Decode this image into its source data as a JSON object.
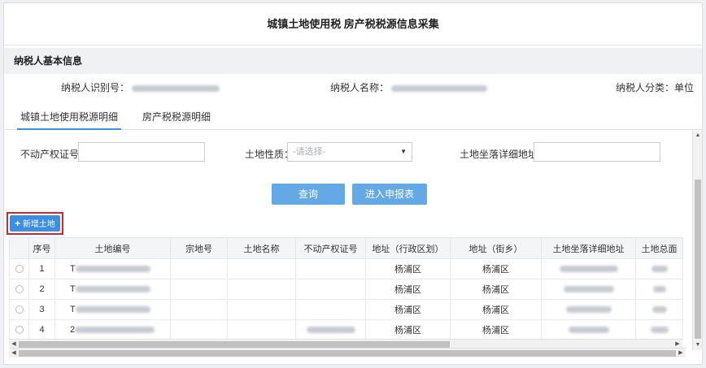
{
  "page": {
    "title": "城镇土地使用税 房产税税源信息采集"
  },
  "basic": {
    "heading": "纳税人基本信息",
    "taxpayer_id_label": "纳税人识别号：",
    "taxpayer_name_label": "纳税人名称：",
    "taxpayer_type_label": "纳税人分类：",
    "taxpayer_type_value": "单位"
  },
  "tabs": [
    {
      "label": "城镇土地使用税源明细",
      "active": true
    },
    {
      "label": "房产税税源明细",
      "active": false
    }
  ],
  "filters": {
    "cert_label": "不动产权证号：",
    "cert_value": "",
    "nature_label": "土地性质：",
    "nature_placeholder": "-请选择-",
    "address_label": "土地坐落详细地址：",
    "address_value": ""
  },
  "buttons": {
    "query": "查询",
    "enter_report": "进入申报表",
    "add_land": "新增土地"
  },
  "table": {
    "headers": [
      "",
      "序号",
      "土地编号",
      "宗地号",
      "土地名称",
      "不动产权证号",
      "地址（行政区划）",
      "地址（街乡）",
      "土地坐落详细地址",
      "土地总面"
    ],
    "rows": [
      {
        "no": "1",
        "land_id_prefix": "T",
        "district": "杨浦区",
        "street": "杨浦区"
      },
      {
        "no": "2",
        "land_id_prefix": "T",
        "district": "杨浦区",
        "street": "杨浦区"
      },
      {
        "no": "3",
        "land_id_prefix": "T",
        "district": "杨浦区",
        "street": "杨浦区"
      },
      {
        "no": "4",
        "land_id_prefix": "2",
        "district": "杨浦区",
        "street": "杨浦区"
      }
    ]
  },
  "icons": {
    "plus": "plus-icon",
    "caret": "caret-down-icon"
  },
  "colors": {
    "primary": "#3c8fe0",
    "button": "#63a9e6",
    "highlight": "#d9232d",
    "tab_active": "#3a8ee6"
  }
}
